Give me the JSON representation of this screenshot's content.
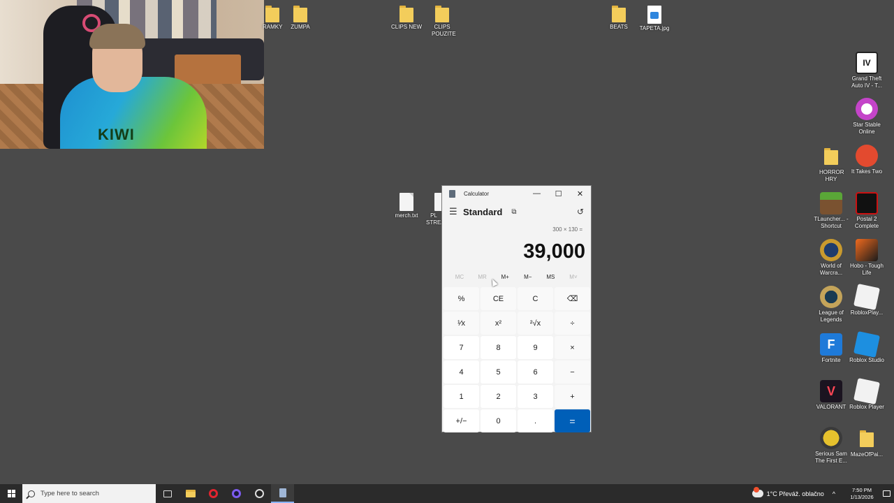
{
  "desktop": {
    "icons": [
      {
        "label": "RAMKY",
        "type": "folder"
      },
      {
        "label": "ZUMPA",
        "type": "folder"
      },
      {
        "label": "CLIPS NEW",
        "type": "folder"
      },
      {
        "label": "CLIPS POUZITE",
        "type": "folder"
      },
      {
        "label": "BEATS",
        "type": "folder"
      },
      {
        "label": "TAPETA.jpg",
        "type": "image-file"
      },
      {
        "label": "merch.txt",
        "type": "text-file"
      },
      {
        "label": "PL STREA",
        "type": "text-file"
      },
      {
        "label": "Grand Theft Auto IV - T...",
        "type": "app"
      },
      {
        "label": "Star Stable Online",
        "type": "app"
      },
      {
        "label": "HORROR HRY",
        "type": "folder"
      },
      {
        "label": "It Takes Two",
        "type": "app"
      },
      {
        "label": "TLauncher... - Shortcut",
        "type": "app"
      },
      {
        "label": "Postal 2 Complete",
        "type": "app"
      },
      {
        "label": "World of Warcra...",
        "type": "app"
      },
      {
        "label": "Hobo - Tough Life",
        "type": "app"
      },
      {
        "label": "League of Legends",
        "type": "app"
      },
      {
        "label": "RobloxPlay...",
        "type": "app"
      },
      {
        "label": "Fortnite",
        "type": "app"
      },
      {
        "label": "Roblox Studio",
        "type": "app"
      },
      {
        "label": "VALORANT",
        "type": "app"
      },
      {
        "label": "Roblox Player",
        "type": "app"
      },
      {
        "label": "Serious Sam The First E...",
        "type": "app"
      },
      {
        "label": "MazeOfPai...",
        "type": "folder"
      }
    ],
    "gta_glyph": "IV",
    "fortnite_glyph": "F",
    "valorant_glyph": "V",
    "webcam_shirt_text": "KIWI"
  },
  "calculator": {
    "window_title": "Calculator",
    "mode": "Standard",
    "expression": "300 × 130 =",
    "result": "39,000",
    "memory": [
      "MC",
      "MR",
      "M+",
      "M−",
      "MS",
      "M˅"
    ],
    "keys": [
      [
        "%",
        "CE",
        "C",
        "⌫"
      ],
      [
        "¹⁄x",
        "x²",
        "²√x",
        "÷"
      ],
      [
        "7",
        "8",
        "9",
        "×"
      ],
      [
        "4",
        "5",
        "6",
        "−"
      ],
      [
        "1",
        "2",
        "3",
        "+"
      ],
      [
        "+/−",
        "0",
        ".",
        "="
      ]
    ],
    "accent_color": "#005fb8"
  },
  "taskbar": {
    "search_placeholder": "Type here to search",
    "weather": "1°C  Převáž. oblačno",
    "time": "7:50 PM",
    "date": "1/13/2026"
  }
}
